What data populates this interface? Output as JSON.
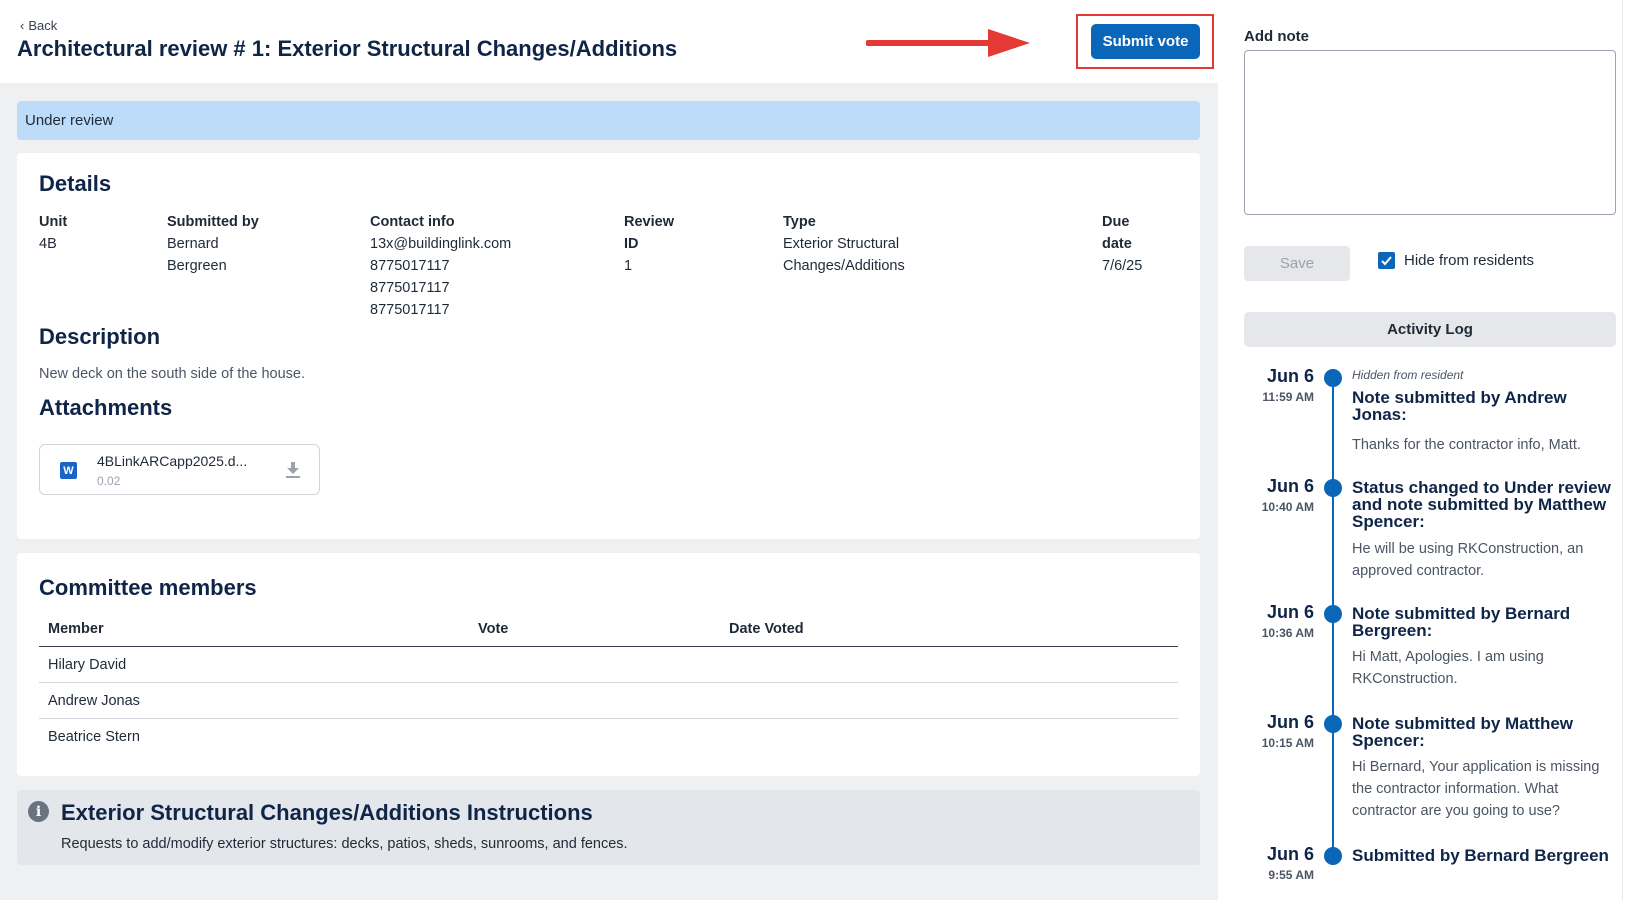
{
  "header": {
    "back_label": "Back",
    "title": "Architectural review # 1: Exterior Structural Changes/Additions",
    "submit_vote_label": "Submit vote"
  },
  "status": "Under review",
  "details": {
    "heading": "Details",
    "unit_label": "Unit",
    "unit": "4B",
    "submitted_by_label": "Submitted by",
    "submitted_by_line1": "Bernard",
    "submitted_by_line2": "Bergreen",
    "contact_label": "Contact info",
    "contact_email": "13x@buildinglink.com",
    "contact_phones": [
      "8775017117",
      "8775017117",
      "8775017117"
    ],
    "review_id_label_line1": "Review",
    "review_id_label_line2": "ID",
    "review_id": "1",
    "type_label": "Type",
    "type_line1": "Exterior Structural",
    "type_line2": "Changes/Additions",
    "due_label_line1": "Due",
    "due_label_line2": "date",
    "due_date": "7/6/25"
  },
  "description": {
    "heading": "Description",
    "text": "New deck on the south side of the house."
  },
  "attachments": {
    "heading": "Attachments",
    "file_name": "4BLinkARCapp2025.d...",
    "file_size": "0.02",
    "file_icon": "W"
  },
  "committee": {
    "heading": "Committee members",
    "columns": [
      "Member",
      "Vote",
      "Date Voted"
    ],
    "rows": [
      {
        "member": "Hilary David",
        "vote": "",
        "date": ""
      },
      {
        "member": "Andrew Jonas",
        "vote": "",
        "date": ""
      },
      {
        "member": "Beatrice Stern",
        "vote": "",
        "date": ""
      }
    ]
  },
  "instructions": {
    "title": "Exterior Structural Changes/Additions Instructions",
    "text": "Requests to add/modify exterior structures: decks, patios, sheds, sunrooms, and fences."
  },
  "side": {
    "add_note_label": "Add note",
    "note_value": "",
    "save_label": "Save",
    "hide_label": "Hide from residents",
    "hide_checked": true,
    "activity_log_label": "Activity Log"
  },
  "activity": [
    {
      "date": "Jun 6",
      "time": "11:59 AM",
      "hidden": "Hidden from resident",
      "title_lines": [
        "Note submitted by Andrew",
        "Jonas:"
      ],
      "body_lines": [
        "Thanks for the contractor info, Matt."
      ]
    },
    {
      "date": "Jun 6",
      "time": "10:40 AM",
      "hidden": "",
      "title_lines": [
        "Status changed to Under review",
        "and note submitted by Matthew",
        "Spencer:"
      ],
      "body_lines": [
        "He will be using RKConstruction, an",
        "approved contractor."
      ]
    },
    {
      "date": "Jun 6",
      "time": "10:36 AM",
      "hidden": "",
      "title_lines": [
        "Note submitted by Bernard",
        "Bergreen:"
      ],
      "body_lines": [
        "Hi Matt, Apologies. I am using",
        "RKConstruction."
      ]
    },
    {
      "date": "Jun 6",
      "time": "10:15 AM",
      "hidden": "",
      "title_lines": [
        "Note submitted by Matthew",
        "Spencer:"
      ],
      "body_lines": [
        "Hi Bernard, Your application is missing",
        "the contractor information. What",
        "contractor are you going to use?"
      ]
    },
    {
      "date": "Jun 6",
      "time": "9:55 AM",
      "hidden": "",
      "title_lines": [
        "Submitted by Bernard Bergreen"
      ],
      "body_lines": []
    }
  ],
  "colors": {
    "primary": "#0a66b8",
    "status_bg": "#bcdcfa",
    "highlight": "#e53935",
    "heading": "#0f2547"
  }
}
